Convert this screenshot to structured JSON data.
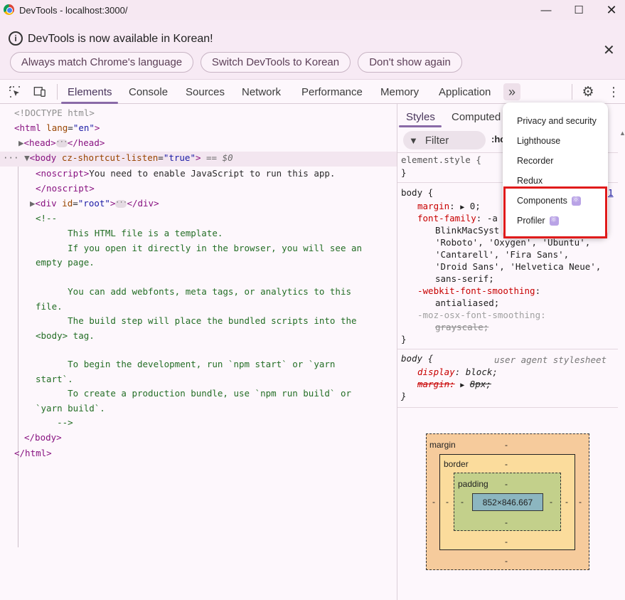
{
  "window": {
    "title": "DevTools - localhost:3000/"
  },
  "infobar": {
    "message": "DevTools is now available in Korean!",
    "btn_match": "Always match Chrome's language",
    "btn_switch": "Switch DevTools to Korean",
    "btn_dismiss": "Don't show again"
  },
  "tabs": [
    "Elements",
    "Console",
    "Sources",
    "Network",
    "Performance",
    "Memory",
    "Application"
  ],
  "elements": {
    "doctype": "<!DOCTYPE html>",
    "html_open": "<html",
    "lang_attr": "lang",
    "lang_val": "\"en\"",
    "head_open": "<head>",
    "head_close": "</head>",
    "body_tag": "<body",
    "body_attr": "cz-shortcut-listen",
    "body_val": "\"true\"",
    "body_close_bracket": ">",
    "dollar": "== $0",
    "noscript_open": "<noscript>",
    "noscript_text": "You need to enable JavaScript to run this app.",
    "noscript_close": "</noscript>",
    "div_open": "<div",
    "div_attr": "id",
    "div_val": "\"root\"",
    "div_close": "</div>",
    "comment_lines": [
      "<!--",
      "      This HTML file is a template.",
      "      If you open it directly in the browser, you will see an",
      "empty page.",
      "",
      "      You can add webfonts, meta tags, or analytics to this",
      "file.",
      "      The build step will place the bundled scripts into the",
      "<body> tag.",
      "",
      "      To begin the development, run `npm start` or `yarn",
      "start`.",
      "      To create a production bundle, use `npm run build` or",
      "`yarn build`.",
      "    -->"
    ],
    "body_end": "</body>",
    "html_end": "</html>"
  },
  "styles": {
    "tab_styles": "Styles",
    "tab_computed": "Computed",
    "filter_placeholder": "Filter",
    "hov": ":ho",
    "element_style": "element.style {",
    "close_brace": "}",
    "body_rule": "body {",
    "margin_prop": "margin",
    "margin_val": "0;",
    "font_family_prop": "font-family",
    "font_family_first": "-a",
    "font_lines": [
      "BlinkMacSyst",
      "'Roboto', 'Oxygen', 'Ubuntu',",
      "'Cantarell', 'Fira Sans',",
      "'Droid Sans', 'Helvetica Neue',",
      "sans-serif;"
    ],
    "webkit_prop": "-webkit-font-smoothing",
    "webkit_val": "antialiased;",
    "moz_prop": "-moz-osx-font-smoothing:",
    "moz_val": "grayscale;",
    "ua_selector": "body {",
    "ua_label": "user agent stylesheet",
    "display_prop": "display",
    "display_val": "block;",
    "ua_margin_prop": "margin:",
    "ua_margin_val": "8px;",
    "source_link": "1"
  },
  "boxmodel": {
    "margin_label": "margin",
    "border_label": "border",
    "padding_label": "padding",
    "dash": "-",
    "content": "852×846.667"
  },
  "menu": {
    "items": [
      "Privacy and security",
      "Lighthouse",
      "Recorder",
      "Redux",
      "Components",
      "Profiler"
    ]
  }
}
